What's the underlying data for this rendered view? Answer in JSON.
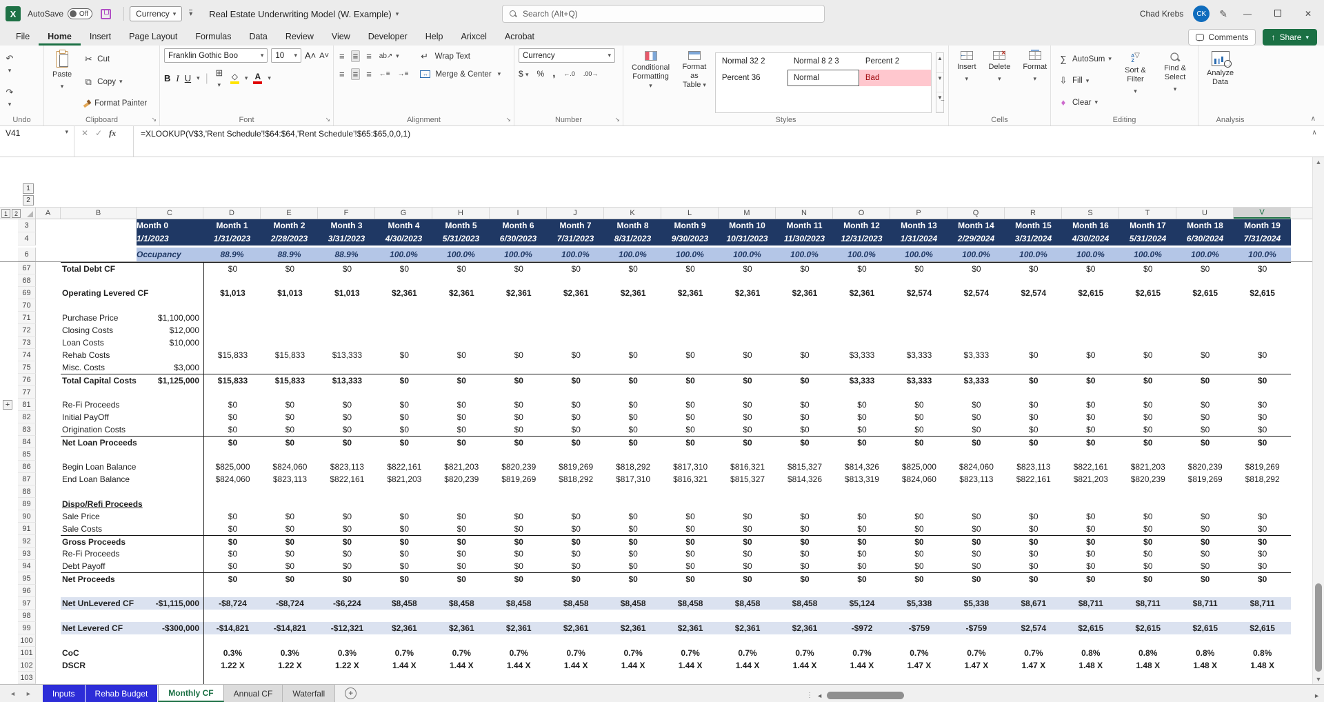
{
  "title_bar": {
    "autosave_label": "AutoSave",
    "autosave_state": "Off",
    "qat_currency": "Currency",
    "file_name": "Real Estate Underwriting Model (W. Example)",
    "search_placeholder": "Search (Alt+Q)",
    "user_name": "Chad Krebs",
    "user_initials": "CK"
  },
  "ribbon": {
    "tabs": [
      "File",
      "Home",
      "Insert",
      "Page Layout",
      "Formulas",
      "Data",
      "Review",
      "View",
      "Developer",
      "Help",
      "Arixcel",
      "Acrobat"
    ],
    "active_tab": "Home",
    "comments": "Comments",
    "share": "Share",
    "undo": {
      "label": "Undo"
    },
    "clipboard": {
      "label": "Clipboard",
      "paste": "Paste",
      "cut": "Cut",
      "copy": "Copy",
      "format_painter": "Format Painter"
    },
    "font": {
      "label": "Font",
      "name": "Franklin Gothic Boo",
      "size": "10",
      "bold": "B",
      "italic": "I",
      "underline": "U"
    },
    "alignment": {
      "label": "Alignment",
      "wrap": "Wrap Text",
      "merge": "Merge & Center"
    },
    "number": {
      "label": "Number",
      "format": "Currency"
    },
    "styles": {
      "label": "Styles",
      "conditional_1": "Conditional",
      "conditional_2": "Formatting",
      "format_table_1": "Format as",
      "format_table_2": "Table",
      "gallery": [
        "Normal 32 2",
        "Normal 8 2 3",
        "Percent 2",
        "Percent 36",
        "Normal",
        "Bad"
      ],
      "selected": "Normal"
    },
    "cells": {
      "label": "Cells",
      "insert": "Insert",
      "delete": "Delete",
      "format": "Format"
    },
    "editing": {
      "label": "Editing",
      "autosum": "AutoSum",
      "fill": "Fill",
      "clear": "Clear",
      "sort": "Sort & Filter",
      "find": "Find & Select"
    },
    "analysis": {
      "label": "Analysis",
      "analyze_1": "Analyze",
      "analyze_2": "Data"
    }
  },
  "formula_bar": {
    "name_box": "V41",
    "fx_label": "fx",
    "formula": "=XLOOKUP(V$3,'Rent Schedule'!$64:$64,'Rent Schedule'!$65:$65,0,0,1)"
  },
  "grid": {
    "outline_levels": [
      "1",
      "2"
    ],
    "columns": [
      "A",
      "B",
      "C",
      "D",
      "E",
      "F",
      "G",
      "H",
      "I",
      "J",
      "K",
      "L",
      "M",
      "N",
      "O",
      "P",
      "Q",
      "R",
      "S",
      "T",
      "U",
      "V"
    ],
    "selected_column": "V",
    "frozen_row_numbers": [
      "3",
      "4",
      "6"
    ],
    "months": [
      "Month 0",
      "Month 1",
      "Month 2",
      "Month 3",
      "Month 4",
      "Month 5",
      "Month 6",
      "Month 7",
      "Month 8",
      "Month 9",
      "Month 10",
      "Month 11",
      "Month 12",
      "Month 13",
      "Month 14",
      "Month 15",
      "Month 16",
      "Month 17",
      "Month 18",
      "Month 19"
    ],
    "dates": [
      "1/1/2023",
      "1/31/2023",
      "2/28/2023",
      "3/31/2023",
      "4/30/2023",
      "5/31/2023",
      "6/30/2023",
      "7/31/2023",
      "8/31/2023",
      "9/30/2023",
      "10/31/2023",
      "11/30/2023",
      "12/31/2023",
      "1/31/2024",
      "2/29/2024",
      "3/31/2024",
      "4/30/2024",
      "5/31/2024",
      "6/30/2024",
      "7/31/2024"
    ],
    "occupancy_label": "Occupancy",
    "occupancy": [
      "88.9%",
      "88.9%",
      "88.9%",
      "100.0%",
      "100.0%",
      "100.0%",
      "100.0%",
      "100.0%",
      "100.0%",
      "100.0%",
      "100.0%",
      "100.0%",
      "100.0%",
      "100.0%",
      "100.0%",
      "100.0%",
      "100.0%",
      "100.0%",
      "100.0%"
    ],
    "rows": [
      {
        "n": "67",
        "label": "Total Debt CF",
        "lb": true,
        "bt": true,
        "v": [
          "$0",
          "$0",
          "$0",
          "$0",
          "$0",
          "$0",
          "$0",
          "$0",
          "$0",
          "$0",
          "$0",
          "$0",
          "$0",
          "$0",
          "$0",
          "$0",
          "$0",
          "$0",
          "$0"
        ]
      },
      {
        "n": "68",
        "blank": true
      },
      {
        "n": "69",
        "label": "Operating Levered CF",
        "lb": true,
        "vb": true,
        "v": [
          "$1,013",
          "$1,013",
          "$1,013",
          "$2,361",
          "$2,361",
          "$2,361",
          "$2,361",
          "$2,361",
          "$2,361",
          "$2,361",
          "$2,361",
          "$2,361",
          "$2,574",
          "$2,574",
          "$2,574",
          "$2,615",
          "$2,615",
          "$2,615",
          "$2,615"
        ]
      },
      {
        "n": "70",
        "blank": true
      },
      {
        "n": "71",
        "label": "Purchase Price",
        "c": "$1,100,000"
      },
      {
        "n": "72",
        "label": "Closing Costs",
        "c": "$12,000"
      },
      {
        "n": "73",
        "label": "Loan Costs",
        "c": "$10,000"
      },
      {
        "n": "74",
        "label": "Rehab Costs",
        "v": [
          "$15,833",
          "$15,833",
          "$13,333",
          "$0",
          "$0",
          "$0",
          "$0",
          "$0",
          "$0",
          "$0",
          "$0",
          "$3,333",
          "$3,333",
          "$3,333",
          "$0",
          "$0",
          "$0",
          "$0",
          "$0"
        ]
      },
      {
        "n": "75",
        "label": "Misc. Costs",
        "c": "$3,000"
      },
      {
        "n": "76",
        "label": "Total Capital Costs",
        "c": "$1,125,000",
        "lb": true,
        "vb": true,
        "bt": true,
        "v": [
          "$15,833",
          "$15,833",
          "$13,333",
          "$0",
          "$0",
          "$0",
          "$0",
          "$0",
          "$0",
          "$0",
          "$0",
          "$3,333",
          "$3,333",
          "$3,333",
          "$0",
          "$0",
          "$0",
          "$0",
          "$0"
        ]
      },
      {
        "n": "77",
        "blank": true
      },
      {
        "n": "81",
        "label": "Re-Fi Proceeds",
        "plus": true,
        "v": [
          "$0",
          "$0",
          "$0",
          "$0",
          "$0",
          "$0",
          "$0",
          "$0",
          "$0",
          "$0",
          "$0",
          "$0",
          "$0",
          "$0",
          "$0",
          "$0",
          "$0",
          "$0",
          "$0"
        ]
      },
      {
        "n": "82",
        "label": "Initial PayOff",
        "v": [
          "$0",
          "$0",
          "$0",
          "$0",
          "$0",
          "$0",
          "$0",
          "$0",
          "$0",
          "$0",
          "$0",
          "$0",
          "$0",
          "$0",
          "$0",
          "$0",
          "$0",
          "$0",
          "$0"
        ]
      },
      {
        "n": "83",
        "label": "Origination Costs",
        "v": [
          "$0",
          "$0",
          "$0",
          "$0",
          "$0",
          "$0",
          "$0",
          "$0",
          "$0",
          "$0",
          "$0",
          "$0",
          "$0",
          "$0",
          "$0",
          "$0",
          "$0",
          "$0",
          "$0"
        ]
      },
      {
        "n": "84",
        "label": "Net Loan Proceeds",
        "lb": true,
        "vb": true,
        "bt": true,
        "v": [
          "$0",
          "$0",
          "$0",
          "$0",
          "$0",
          "$0",
          "$0",
          "$0",
          "$0",
          "$0",
          "$0",
          "$0",
          "$0",
          "$0",
          "$0",
          "$0",
          "$0",
          "$0",
          "$0"
        ]
      },
      {
        "n": "85",
        "blank": true
      },
      {
        "n": "86",
        "label": "Begin Loan Balance",
        "v": [
          "$825,000",
          "$824,060",
          "$823,113",
          "$822,161",
          "$821,203",
          "$820,239",
          "$819,269",
          "$818,292",
          "$817,310",
          "$816,321",
          "$815,327",
          "$814,326",
          "$825,000",
          "$824,060",
          "$823,113",
          "$822,161",
          "$821,203",
          "$820,239",
          "$819,269"
        ]
      },
      {
        "n": "87",
        "label": "End Loan Balance",
        "v": [
          "$824,060",
          "$823,113",
          "$822,161",
          "$821,203",
          "$820,239",
          "$819,269",
          "$818,292",
          "$817,310",
          "$816,321",
          "$815,327",
          "$814,326",
          "$813,319",
          "$824,060",
          "$823,113",
          "$822,161",
          "$821,203",
          "$820,239",
          "$819,269",
          "$818,292"
        ]
      },
      {
        "n": "88",
        "blank": true
      },
      {
        "n": "89",
        "label": "Dispo/Refi Proceeds",
        "lb": true,
        "ul": true
      },
      {
        "n": "90",
        "label": "Sale Price",
        "v": [
          "$0",
          "$0",
          "$0",
          "$0",
          "$0",
          "$0",
          "$0",
          "$0",
          "$0",
          "$0",
          "$0",
          "$0",
          "$0",
          "$0",
          "$0",
          "$0",
          "$0",
          "$0",
          "$0"
        ]
      },
      {
        "n": "91",
        "label": "Sale Costs",
        "v": [
          "$0",
          "$0",
          "$0",
          "$0",
          "$0",
          "$0",
          "$0",
          "$0",
          "$0",
          "$0",
          "$0",
          "$0",
          "$0",
          "$0",
          "$0",
          "$0",
          "$0",
          "$0",
          "$0"
        ]
      },
      {
        "n": "92",
        "label": "Gross Proceeds",
        "lb": true,
        "vb": true,
        "bt": true,
        "v": [
          "$0",
          "$0",
          "$0",
          "$0",
          "$0",
          "$0",
          "$0",
          "$0",
          "$0",
          "$0",
          "$0",
          "$0",
          "$0",
          "$0",
          "$0",
          "$0",
          "$0",
          "$0",
          "$0"
        ]
      },
      {
        "n": "93",
        "label": "Re-Fi Proceeds",
        "v": [
          "$0",
          "$0",
          "$0",
          "$0",
          "$0",
          "$0",
          "$0",
          "$0",
          "$0",
          "$0",
          "$0",
          "$0",
          "$0",
          "$0",
          "$0",
          "$0",
          "$0",
          "$0",
          "$0"
        ]
      },
      {
        "n": "94",
        "label": "Debt Payoff",
        "v": [
          "$0",
          "$0",
          "$0",
          "$0",
          "$0",
          "$0",
          "$0",
          "$0",
          "$0",
          "$0",
          "$0",
          "$0",
          "$0",
          "$0",
          "$0",
          "$0",
          "$0",
          "$0",
          "$0"
        ]
      },
      {
        "n": "95",
        "label": "Net Proceeds",
        "lb": true,
        "vb": true,
        "bt": true,
        "v": [
          "$0",
          "$0",
          "$0",
          "$0",
          "$0",
          "$0",
          "$0",
          "$0",
          "$0",
          "$0",
          "$0",
          "$0",
          "$0",
          "$0",
          "$0",
          "$0",
          "$0",
          "$0",
          "$0"
        ]
      },
      {
        "n": "96",
        "blank": true
      },
      {
        "n": "97",
        "label": "Net UnLevered CF",
        "c": "-$1,115,000",
        "lb": true,
        "vb": true,
        "hl": true,
        "v": [
          "-$8,724",
          "-$8,724",
          "-$6,224",
          "$8,458",
          "$8,458",
          "$8,458",
          "$8,458",
          "$8,458",
          "$8,458",
          "$8,458",
          "$8,458",
          "$5,124",
          "$5,338",
          "$5,338",
          "$8,671",
          "$8,711",
          "$8,711",
          "$8,711",
          "$8,711"
        ]
      },
      {
        "n": "98",
        "blank": true
      },
      {
        "n": "99",
        "label": "Net Levered CF",
        "c": "-$300,000",
        "lb": true,
        "vb": true,
        "hl": true,
        "v": [
          "-$14,821",
          "-$14,821",
          "-$12,321",
          "$2,361",
          "$2,361",
          "$2,361",
          "$2,361",
          "$2,361",
          "$2,361",
          "$2,361",
          "$2,361",
          "-$972",
          "-$759",
          "-$759",
          "$2,574",
          "$2,615",
          "$2,615",
          "$2,615",
          "$2,615"
        ]
      },
      {
        "n": "100",
        "blank": true
      },
      {
        "n": "101",
        "label": "CoC",
        "lb": true,
        "vb": true,
        "v": [
          "0.3%",
          "0.3%",
          "0.3%",
          "0.7%",
          "0.7%",
          "0.7%",
          "0.7%",
          "0.7%",
          "0.7%",
          "0.7%",
          "0.7%",
          "0.7%",
          "0.7%",
          "0.7%",
          "0.7%",
          "0.8%",
          "0.8%",
          "0.8%",
          "0.8%"
        ]
      },
      {
        "n": "102",
        "label": "DSCR",
        "lb": true,
        "vb": true,
        "v": [
          "1.22 X",
          "1.22 X",
          "1.22 X",
          "1.44 X",
          "1.44 X",
          "1.44 X",
          "1.44 X",
          "1.44 X",
          "1.44 X",
          "1.44 X",
          "1.44 X",
          "1.44 X",
          "1.47 X",
          "1.47 X",
          "1.47 X",
          "1.48 X",
          "1.48 X",
          "1.48 X",
          "1.48 X"
        ]
      },
      {
        "n": "103",
        "blank": true
      }
    ]
  },
  "sheet_tabs": {
    "tabs": [
      {
        "label": "Inputs",
        "style": "blue"
      },
      {
        "label": "Rehab Budget",
        "style": "blue"
      },
      {
        "label": "Monthly CF",
        "style": "active"
      },
      {
        "label": "Annual CF",
        "style": "plain"
      },
      {
        "label": "Waterfall",
        "style": "plain"
      }
    ],
    "add": "+"
  }
}
